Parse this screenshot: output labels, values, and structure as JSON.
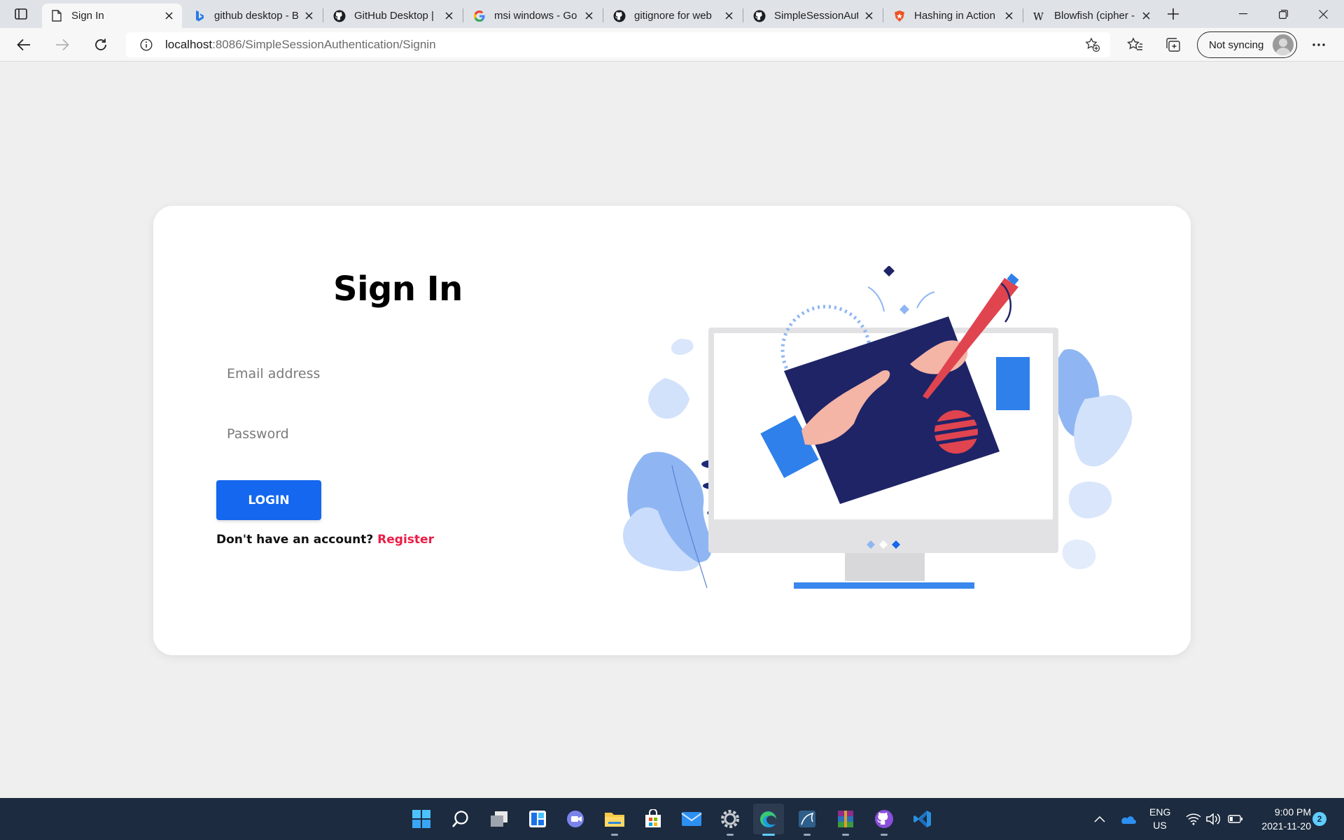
{
  "browser": {
    "tabs": [
      {
        "label": "Sign In",
        "icon": "page-icon",
        "active": true
      },
      {
        "label": "github desktop - B",
        "icon": "bing-icon"
      },
      {
        "label": "GitHub Desktop |",
        "icon": "github-icon"
      },
      {
        "label": "msi windows - Go",
        "icon": "google-icon"
      },
      {
        "label": "gitignore for web",
        "icon": "github-icon"
      },
      {
        "label": "SimpleSessionAut",
        "icon": "github-icon"
      },
      {
        "label": "Hashing in Action",
        "icon": "auth0-icon"
      },
      {
        "label": "Blowfish (cipher -",
        "icon": "wikipedia-icon"
      }
    ],
    "address": {
      "host": "localhost",
      "path": ":8086/SimpleSessionAuthentication/Signin"
    },
    "sync_label": "Not syncing"
  },
  "page": {
    "title": "Sign In",
    "email_placeholder": "Email address",
    "password_placeholder": "Password",
    "login_label": "LOGIN",
    "register_prompt": "Don't have an account?",
    "register_link": "Register",
    "accent_color": "#1467ee",
    "link_color": "#ec1c44"
  },
  "taskbar": {
    "apps": [
      "start-icon",
      "search-icon",
      "task-view-icon",
      "widgets-icon",
      "teams-chat-icon",
      "file-explorer-icon",
      "store-icon",
      "mail-icon",
      "settings-icon",
      "edge-icon",
      "mysql-workbench-icon",
      "winrar-icon",
      "github-desktop-icon",
      "vscode-icon"
    ],
    "lang_line1": "ENG",
    "lang_line2": "US",
    "time": "9:00 PM",
    "date": "2021-11-20",
    "notification_count": "2"
  }
}
